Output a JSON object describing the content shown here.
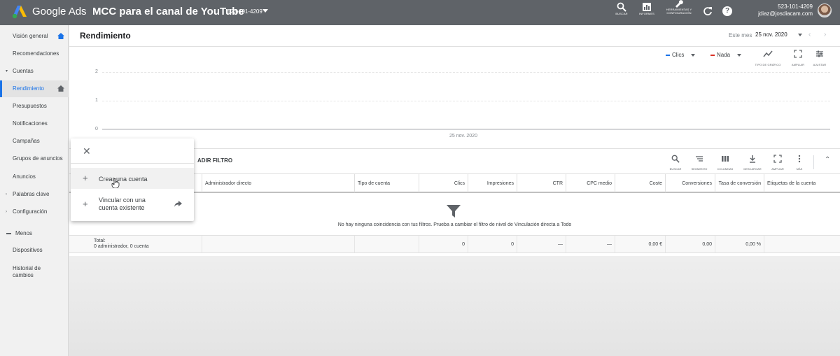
{
  "topbar": {
    "brand": "Google Ads",
    "account_title": "MCC para el canal de YouTube",
    "account_id": "523-101-4209",
    "tools": [
      {
        "icon": "search-icon",
        "label": "BUSCAR"
      },
      {
        "icon": "reports-icon",
        "label": "INFORMES"
      },
      {
        "icon": "wrench-icon",
        "label": "HERRAMIENTAS Y CONFIGURACIÓN"
      }
    ],
    "user_id": "523-101-4209",
    "user_email": "jdiaz@josdiacam.com"
  },
  "sidebar": {
    "items": [
      {
        "label": "Visión general",
        "home": true
      },
      {
        "label": "Recomendaciones"
      },
      {
        "label": "Cuentas",
        "caret": "▾"
      },
      {
        "label": "Rendimiento",
        "active": true,
        "home": true
      },
      {
        "label": "Presupuestos"
      },
      {
        "label": "Notificaciones"
      },
      {
        "label": "Campañas"
      },
      {
        "label": "Grupos de anuncios"
      },
      {
        "label": "Anuncios"
      },
      {
        "label": "Palabras clave",
        "caret": "›"
      },
      {
        "label": "Configuración",
        "caret": "›"
      },
      {
        "label": "Menos"
      },
      {
        "label": "Dispositivos"
      },
      {
        "label": "Historial de cambios"
      }
    ]
  },
  "main": {
    "title": "Rendimiento",
    "date_label": "Este mes",
    "date_value": "25 nov. 2020",
    "metrics": [
      {
        "label": "Clics",
        "color": "#1a73e8"
      },
      {
        "label": "Nada",
        "color": "#d93025"
      }
    ],
    "chart_tools": [
      {
        "icon": "chart-type-icon",
        "label": "TIPO DE GRÁFICO"
      },
      {
        "icon": "expand-icon",
        "label": "AMPLIAR"
      },
      {
        "icon": "adjust-icon",
        "label": "AJUSTAR"
      }
    ],
    "filter_text": "ADIR FILTRO",
    "table_tools": [
      {
        "icon": "search-icon",
        "label": "BUSCAR"
      },
      {
        "icon": "segment-icon",
        "label": "SEGMENTO"
      },
      {
        "icon": "columns-icon",
        "label": "COLUMNAS"
      },
      {
        "icon": "download-icon",
        "label": "DESCARGAR"
      },
      {
        "icon": "expand-icon",
        "label": "AMPLIAR"
      },
      {
        "icon": "more-icon",
        "label": "MÁS"
      }
    ],
    "columns": [
      "Administrador directo",
      "Tipo de cuenta",
      "Clics",
      "Impresiones",
      "CTR",
      "CPC medio",
      "Coste",
      "Conversiones",
      "Tasa de conversión",
      "Etiquetas de la cuenta"
    ],
    "empty_message": "No hay ninguna coincidencia con tus filtros. Prueba a cambiar el filtro de nivel de Vinculación directa a Todo",
    "total": {
      "label": "Total:",
      "sublabel": "0 administrador, 0 cuenta",
      "clics": "0",
      "impresiones": "0",
      "ctr": "—",
      "cpc": "—",
      "coste": "0,00 €",
      "conversiones": "0,00",
      "tasa": "0,00 %"
    }
  },
  "chart_data": {
    "type": "line",
    "title": "",
    "xlabel": "",
    "ylabel": "",
    "x": [
      "25 nov. 2020"
    ],
    "series": [
      {
        "name": "Clics",
        "values": [
          0
        ]
      }
    ],
    "yticks": [
      "2",
      "1",
      "0"
    ],
    "ylim": [
      0,
      2
    ]
  },
  "popup": {
    "items": [
      {
        "label": "Crear una cuenta"
      },
      {
        "label": "Vincular con una cuenta existente"
      }
    ]
  }
}
